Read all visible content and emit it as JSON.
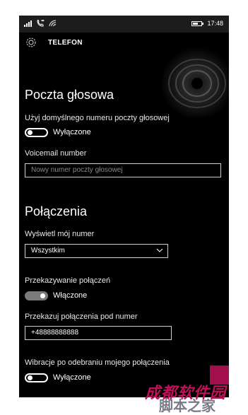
{
  "status_bar": {
    "time": "17:48",
    "battery_level": 0.55
  },
  "header": {
    "title": "TELEFON",
    "icon": "gear-icon"
  },
  "voicemail": {
    "section_title": "Poczta głosowa",
    "default_number_label": "Użyj domyślnego numeru poczty głosowej",
    "default_number_toggle_state": "Wyłączone",
    "voicemail_number_label": "Voicemail number",
    "voicemail_number_placeholder": "Nowy numer poczty głosowej"
  },
  "calls": {
    "section_title": "Połączenia",
    "show_my_number_label": "Wyświetl mój numer",
    "show_my_number_value": "Wszystkim",
    "forwarding_label": "Przekazywanie połączeń",
    "forwarding_toggle_state": "Włączone",
    "forward_to_label": "Przekazuj połączenia pod numer",
    "forward_to_value": "+48888888888",
    "vibrate_label": "Wibracje po odebraniu mojego połączenia",
    "vibrate_toggle_state": "Wyłączone"
  },
  "watermark": {
    "line1": "成都软件园",
    "line2": "脚本之家"
  },
  "colors": {
    "background": "#000000",
    "text": "#ffffff",
    "toggle_on": "#7a7a7a",
    "watermark": "#c0105a"
  }
}
